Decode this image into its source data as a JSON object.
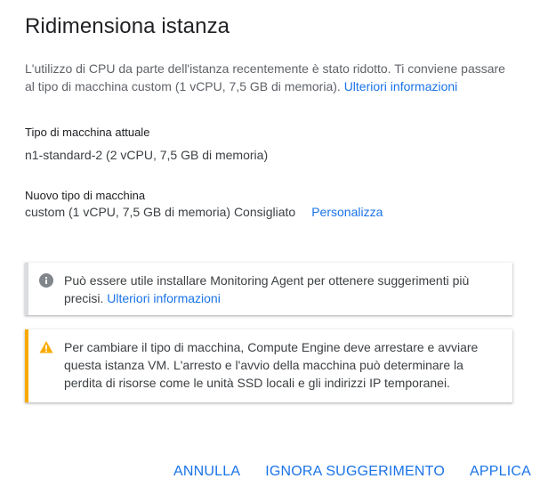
{
  "dialog": {
    "title": "Ridimensiona istanza",
    "description": "L'utilizzo di CPU da parte dell'istanza recentemente è stato ridotto. Ti conviene passare al tipo di macchina custom (1 vCPU, 7,5 GB di memoria).",
    "description_link": "Ulteriori informazioni"
  },
  "current_machine": {
    "label": "Tipo di macchina attuale",
    "value": "n1-standard-2 (2 vCPU, 7,5 GB di memoria)"
  },
  "new_machine": {
    "label": "Nuovo tipo di macchina",
    "value": "custom (1 vCPU, 7,5 GB di memoria) Consigliato",
    "customize_link": "Personalizza"
  },
  "info_callout": {
    "icon": "info-icon",
    "text": "Può essere utile installare Monitoring Agent per ottenere suggerimenti più precisi.",
    "link": "Ulteriori informazioni"
  },
  "warning_callout": {
    "icon": "warning-icon",
    "text": "Per cambiare il tipo di macchina, Compute Engine deve arrestare e avviare questa istanza VM. L'arresto e l'avvio della macchina può determinare la perdita di risorse come le unità SSD locali e gli indirizzi IP temporanei."
  },
  "actions": {
    "cancel": "ANNULLA",
    "ignore": "IGNORA SUGGERIMENTO",
    "apply": "APPLICA"
  },
  "colors": {
    "link": "#1a73e8",
    "warning_accent": "#f9ab00",
    "info_icon": "#80868b"
  }
}
